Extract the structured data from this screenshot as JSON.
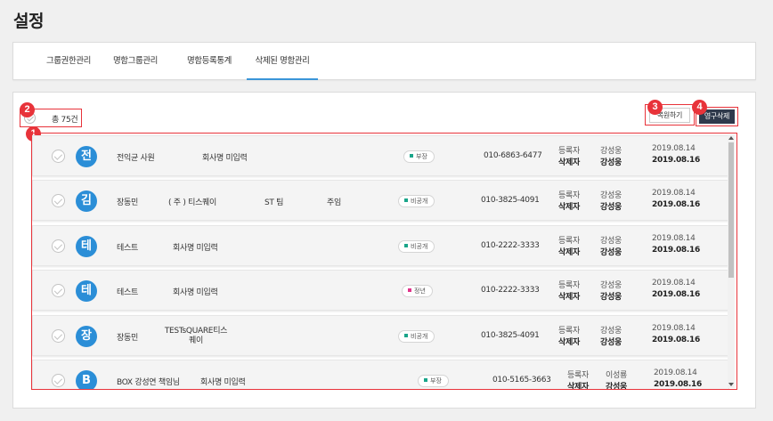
{
  "page": {
    "title": "설정"
  },
  "tabs": [
    {
      "label": "그룹권한관리",
      "active": false
    },
    {
      "label": "명함그룹관리",
      "active": false
    },
    {
      "label": "명함등록통계",
      "active": false
    },
    {
      "label": "삭제된 명함관리",
      "active": true
    }
  ],
  "toolbar": {
    "total_label": "총 75건",
    "restore_label": "복원하기",
    "delete_label": "영구삭제"
  },
  "annotations": [
    "1",
    "2",
    "3",
    "4"
  ],
  "colors": {
    "accent": "#2b8ed7",
    "annotation": "#e8333a",
    "delete_button": "#2f3a4c",
    "tab_underline": "#3a95d8"
  },
  "rows": [
    {
      "avatar": "전",
      "name": "전익균 사원",
      "company": "회사명 미입력",
      "team": "",
      "title": "",
      "tag": "부장",
      "tag_color": "#1aa58a",
      "phone": "010-6863-6477",
      "registrant_label": "등록자",
      "registrant": "강성웅",
      "deleter_label": "삭제자",
      "deleter": "강성웅",
      "reg_date": "2019.08.14",
      "del_date": "2019.08.16"
    },
    {
      "avatar": "김",
      "name": "장동민",
      "company": "( 주 ) 티스퀘이",
      "team": "ST 팀",
      "title": "주임",
      "tag": "비공개",
      "tag_color": "#1aa58a",
      "phone": "010-3825-4091",
      "registrant_label": "등록자",
      "registrant": "강성웅",
      "deleter_label": "삭제자",
      "deleter": "강성웅",
      "reg_date": "2019.08.14",
      "del_date": "2019.08.16"
    },
    {
      "avatar": "테",
      "name": "테스트",
      "company": "회사명 미입력",
      "team": "",
      "title": "",
      "tag": "비공개",
      "tag_color": "#1aa58a",
      "phone": "010-2222-3333",
      "registrant_label": "등록자",
      "registrant": "강성웅",
      "deleter_label": "삭제자",
      "deleter": "강성웅",
      "reg_date": "2019.08.14",
      "del_date": "2019.08.16"
    },
    {
      "avatar": "테",
      "name": "테스트",
      "company": "회사명 미입력",
      "team": "",
      "title": "",
      "tag": "정년",
      "tag_color": "#e0338a",
      "phone": "010-2222-3333",
      "registrant_label": "등록자",
      "registrant": "강성웅",
      "deleter_label": "삭제자",
      "deleter": "강성웅",
      "reg_date": "2019.08.14",
      "del_date": "2019.08.16"
    },
    {
      "avatar": "장",
      "name": "장동민",
      "company": "TESTsQUARE티스퀘이",
      "team": "",
      "title": "",
      "tag": "비공개",
      "tag_color": "#1aa58a",
      "phone": "010-3825-4091",
      "registrant_label": "등록자",
      "registrant": "강성웅",
      "deleter_label": "삭제자",
      "deleter": "강성웅",
      "reg_date": "2019.08.14",
      "del_date": "2019.08.16"
    },
    {
      "avatar": "B",
      "name": "BOX 강성연 책임님",
      "company": "회사명 미입력",
      "team": "",
      "title": "",
      "tag": "부장",
      "tag_color": "#1aa58a",
      "phone": "010-5165-3663",
      "registrant_label": "등록자",
      "registrant": "이성룡",
      "deleter_label": "삭제자",
      "deleter": "강성웅",
      "reg_date": "2019.08.14",
      "del_date": "2019.08.16"
    }
  ]
}
